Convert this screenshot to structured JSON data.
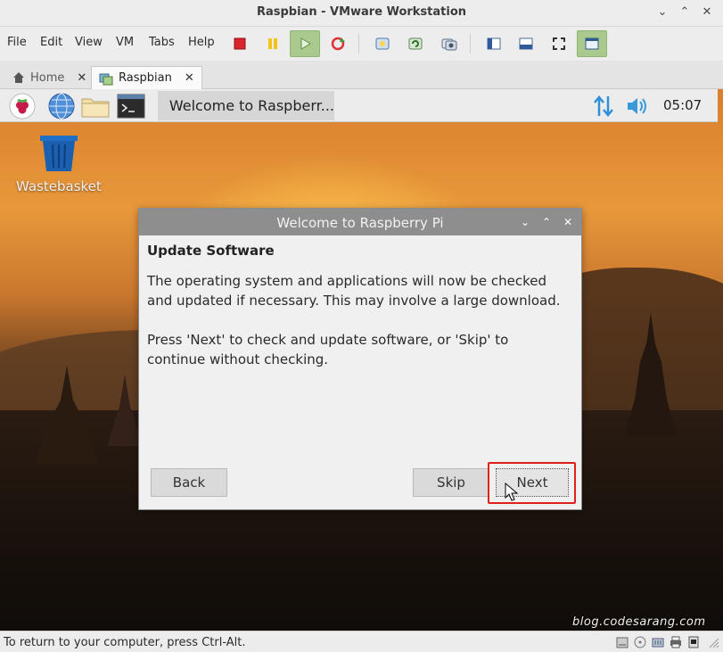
{
  "window": {
    "title": "Raspbian - VMware Workstation"
  },
  "menubar": {
    "items": [
      "File",
      "Edit",
      "View",
      "VM",
      "Tabs",
      "Help"
    ]
  },
  "toolbar": {
    "icons": [
      "power-stop-icon",
      "pause-icon",
      "play-icon",
      "refresh-icon",
      "snapshot-icon",
      "snapshot-revert-icon",
      "snapshot-manager-icon",
      "library-icon",
      "console-icon",
      "fullscreen-icon",
      "unity-icon"
    ]
  },
  "tabs": [
    {
      "label": "Home",
      "active": false
    },
    {
      "label": "Raspbian",
      "active": true
    }
  ],
  "guest": {
    "taskbar": {
      "window_button_label": "Welcome to Raspberr...",
      "clock": "05:07"
    },
    "desktop_icon_label": "Wastebasket",
    "dialog": {
      "title": "Welcome to Raspberry Pi",
      "heading": "Update Software",
      "paragraph1": "The operating system and applications will now be checked and updated if necessary. This may involve a large download.",
      "paragraph2": "Press 'Next' to check and update software, or 'Skip' to continue without checking.",
      "back_label": "Back",
      "skip_label": "Skip",
      "next_label": "Next"
    }
  },
  "watermark": "blog.codesarang.com",
  "statusbar": {
    "text": "To return to your computer, press Ctrl-Alt."
  },
  "colors": {
    "highlight": "#e0201b",
    "dialog_titlebar": "#8e8e8e",
    "active_toolbar": "#a9c98e"
  }
}
